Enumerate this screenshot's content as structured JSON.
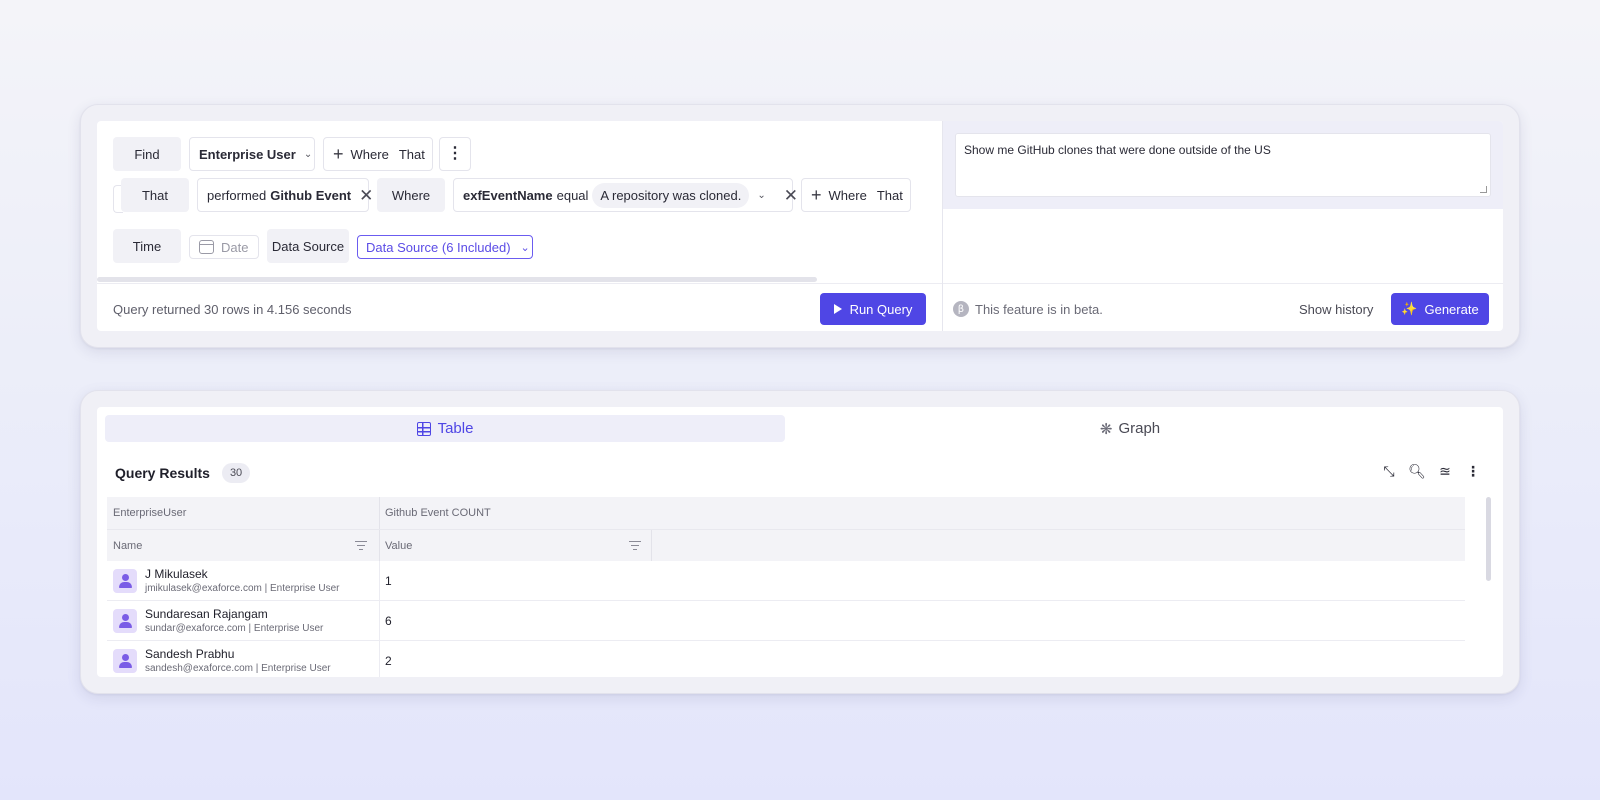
{
  "query_builder": {
    "find_label": "Find",
    "entity": "Enterprise User",
    "where_label": "Where",
    "that_label": "That",
    "that_row": {
      "label": "That",
      "action_prefix": "performed",
      "action_event": "Github Event",
      "where_label": "Where",
      "field": "exfEventName",
      "operator": "equal",
      "value": "A repository was cloned.",
      "add_where": "Where",
      "add_that": "That"
    },
    "time_label": "Time",
    "date_placeholder": "Date",
    "data_source_label": "Data Source",
    "data_source_value": "Data Source (6 Included)",
    "status": "Query returned 30 rows in 4.156 seconds",
    "run_button": "Run Query"
  },
  "assistant": {
    "prompt": "Show me GitHub clones that were done outside of the US",
    "beta_icon": "β",
    "beta_text": "This feature is in beta.",
    "history_link": "Show history",
    "generate_button": "Generate"
  },
  "results": {
    "tabs": [
      {
        "label": "Table",
        "icon": "table-icon",
        "active": true
      },
      {
        "label": "Graph",
        "icon": "graph-icon",
        "active": false
      }
    ],
    "title": "Query Results",
    "count": "30",
    "group_headers": [
      "EnterpriseUser",
      "Github Event COUNT"
    ],
    "column_headers": [
      "Name",
      "Value"
    ],
    "rows": [
      {
        "name": "J Mikulasek",
        "meta": "jmikulasek@exaforce.com | Enterprise User",
        "value": "1"
      },
      {
        "name": "Sundaresan Rajangam",
        "meta": "sundar@exaforce.com | Enterprise User",
        "value": "6"
      },
      {
        "name": "Sandesh Prabhu",
        "meta": "sandesh@exaforce.com | Enterprise User",
        "value": "2"
      }
    ]
  },
  "colors": {
    "accent": "#4f46e5",
    "avatar_bg": "#e4dcfb",
    "avatar_fg": "#7a5ce6",
    "tab_active_bg": "#eeeef9"
  }
}
